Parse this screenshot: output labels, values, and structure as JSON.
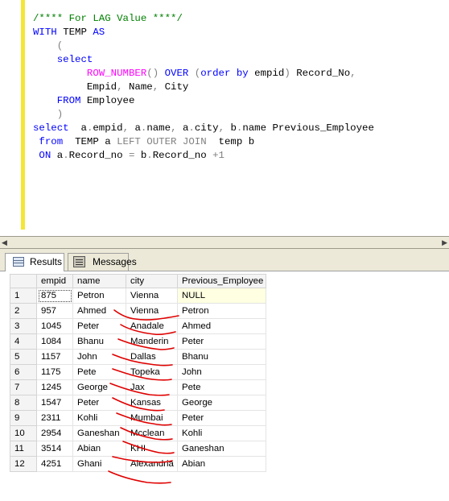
{
  "editor": {
    "lines": [
      [
        {
          "t": "/**** For LAG Value ****/",
          "c": "c"
        }
      ],
      [
        {
          "t": "WITH ",
          "c": "k"
        },
        {
          "t": "TEMP ",
          "c": "n"
        },
        {
          "t": "AS",
          "c": "k"
        }
      ],
      [
        {
          "t": "    (",
          "c": "g"
        }
      ],
      [
        {
          "t": "    select",
          "c": "k"
        }
      ],
      [
        {
          "t": "         ",
          "c": "n"
        },
        {
          "t": "ROW_NUMBER",
          "c": "f"
        },
        {
          "t": "() ",
          "c": "g"
        },
        {
          "t": "OVER ",
          "c": "k"
        },
        {
          "t": "(",
          "c": "g"
        },
        {
          "t": "order by ",
          "c": "k"
        },
        {
          "t": "empid",
          "c": "n"
        },
        {
          "t": ") ",
          "c": "g"
        },
        {
          "t": "Record_No",
          "c": "n"
        },
        {
          "t": ",",
          "c": "g"
        }
      ],
      [
        {
          "t": "         Empid",
          "c": "n"
        },
        {
          "t": ", ",
          "c": "g"
        },
        {
          "t": "Name",
          "c": "n"
        },
        {
          "t": ", ",
          "c": "g"
        },
        {
          "t": "City",
          "c": "n"
        }
      ],
      [
        {
          "t": "    FROM ",
          "c": "k"
        },
        {
          "t": "Employee",
          "c": "n"
        }
      ],
      [
        {
          "t": "    )",
          "c": "g"
        }
      ],
      [
        {
          "t": "select  ",
          "c": "k"
        },
        {
          "t": "a",
          "c": "n"
        },
        {
          "t": ".",
          "c": "g"
        },
        {
          "t": "empid",
          "c": "n"
        },
        {
          "t": ", ",
          "c": "g"
        },
        {
          "t": "a",
          "c": "n"
        },
        {
          "t": ".",
          "c": "g"
        },
        {
          "t": "name",
          "c": "n"
        },
        {
          "t": ", ",
          "c": "g"
        },
        {
          "t": "a",
          "c": "n"
        },
        {
          "t": ".",
          "c": "g"
        },
        {
          "t": "city",
          "c": "n"
        },
        {
          "t": ", ",
          "c": "g"
        },
        {
          "t": "b",
          "c": "n"
        },
        {
          "t": ".",
          "c": "g"
        },
        {
          "t": "name Previous_Employee",
          "c": "n"
        }
      ],
      [
        {
          "t": " from  ",
          "c": "k"
        },
        {
          "t": "TEMP a ",
          "c": "n"
        },
        {
          "t": "LEFT OUTER JOIN  ",
          "c": "g"
        },
        {
          "t": "temp b",
          "c": "n"
        }
      ],
      [
        {
          "t": " ON ",
          "c": "k"
        },
        {
          "t": "a",
          "c": "n"
        },
        {
          "t": ".",
          "c": "g"
        },
        {
          "t": "Record_no ",
          "c": "n"
        },
        {
          "t": "= ",
          "c": "g"
        },
        {
          "t": "b",
          "c": "n"
        },
        {
          "t": ".",
          "c": "g"
        },
        {
          "t": "Record_no ",
          "c": "n"
        },
        {
          "t": "+1",
          "c": "g"
        }
      ]
    ]
  },
  "tabs": {
    "results_label": "Results",
    "messages_label": "Messages"
  },
  "grid": {
    "columns": [
      "empid",
      "name",
      "city",
      "Previous_Employee"
    ],
    "rows": [
      {
        "n": "1",
        "empid": "875",
        "name": "Petron",
        "city": "Vienna",
        "prev": "NULL"
      },
      {
        "n": "2",
        "empid": "957",
        "name": "Ahmed",
        "city": "Vienna",
        "prev": "Petron"
      },
      {
        "n": "3",
        "empid": "1045",
        "name": "Peter",
        "city": "Anadale",
        "prev": "Ahmed"
      },
      {
        "n": "4",
        "empid": "1084",
        "name": "Bhanu",
        "city": "Manderin",
        "prev": "Peter"
      },
      {
        "n": "5",
        "empid": "1157",
        "name": "John",
        "city": "Dallas",
        "prev": "Bhanu"
      },
      {
        "n": "6",
        "empid": "1175",
        "name": "Pete",
        "city": "Topeka",
        "prev": "John"
      },
      {
        "n": "7",
        "empid": "1245",
        "name": "George",
        "city": "Jax",
        "prev": "Pete"
      },
      {
        "n": "8",
        "empid": "1547",
        "name": "Peter",
        "city": "Kansas",
        "prev": "George"
      },
      {
        "n": "9",
        "empid": "2311",
        "name": "Kohli",
        "city": "Mumbai",
        "prev": "Peter"
      },
      {
        "n": "10",
        "empid": "2954",
        "name": "Ganeshan",
        "city": "Mcclean",
        "prev": "Kohli"
      },
      {
        "n": "11",
        "empid": "3514",
        "name": "Abian",
        "city": "KHI",
        "prev": "Ganeshan"
      },
      {
        "n": "12",
        "empid": "4251",
        "name": "Ghani",
        "city": "Alexandria",
        "prev": "Abian"
      }
    ]
  },
  "colors": {
    "keyword": "#0000ff",
    "function": "#ff00ff",
    "comment": "#008000",
    "operator": "#808080",
    "annotation": "#e00000",
    "change_bar": "#f5e634"
  }
}
